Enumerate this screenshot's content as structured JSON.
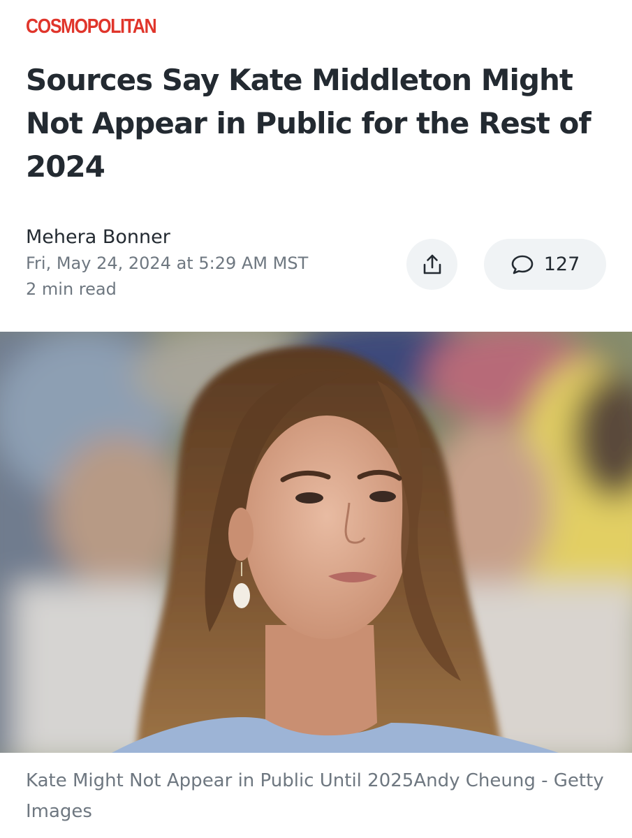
{
  "article": {
    "source": "COSMOPOLITAN",
    "headline": "Sources Say Kate Middleton Might Not Appear in Public for the Rest of 2024",
    "author": "Mehera Bonner",
    "date": "Fri, May 24, 2024 at 5:29 AM MST",
    "read_time": "2 min read"
  },
  "actions": {
    "share_icon": "share-icon",
    "comment_icon": "comment-bubble-icon",
    "comment_count": "127"
  },
  "image": {
    "caption": "Kate Might Not Appear in Public Until 2025Andy Cheung - Getty Images"
  },
  "colors": {
    "brand": "#e0352b",
    "text_primary": "#232a31",
    "text_secondary": "#6e7780",
    "button_bg": "#f0f3f5"
  }
}
